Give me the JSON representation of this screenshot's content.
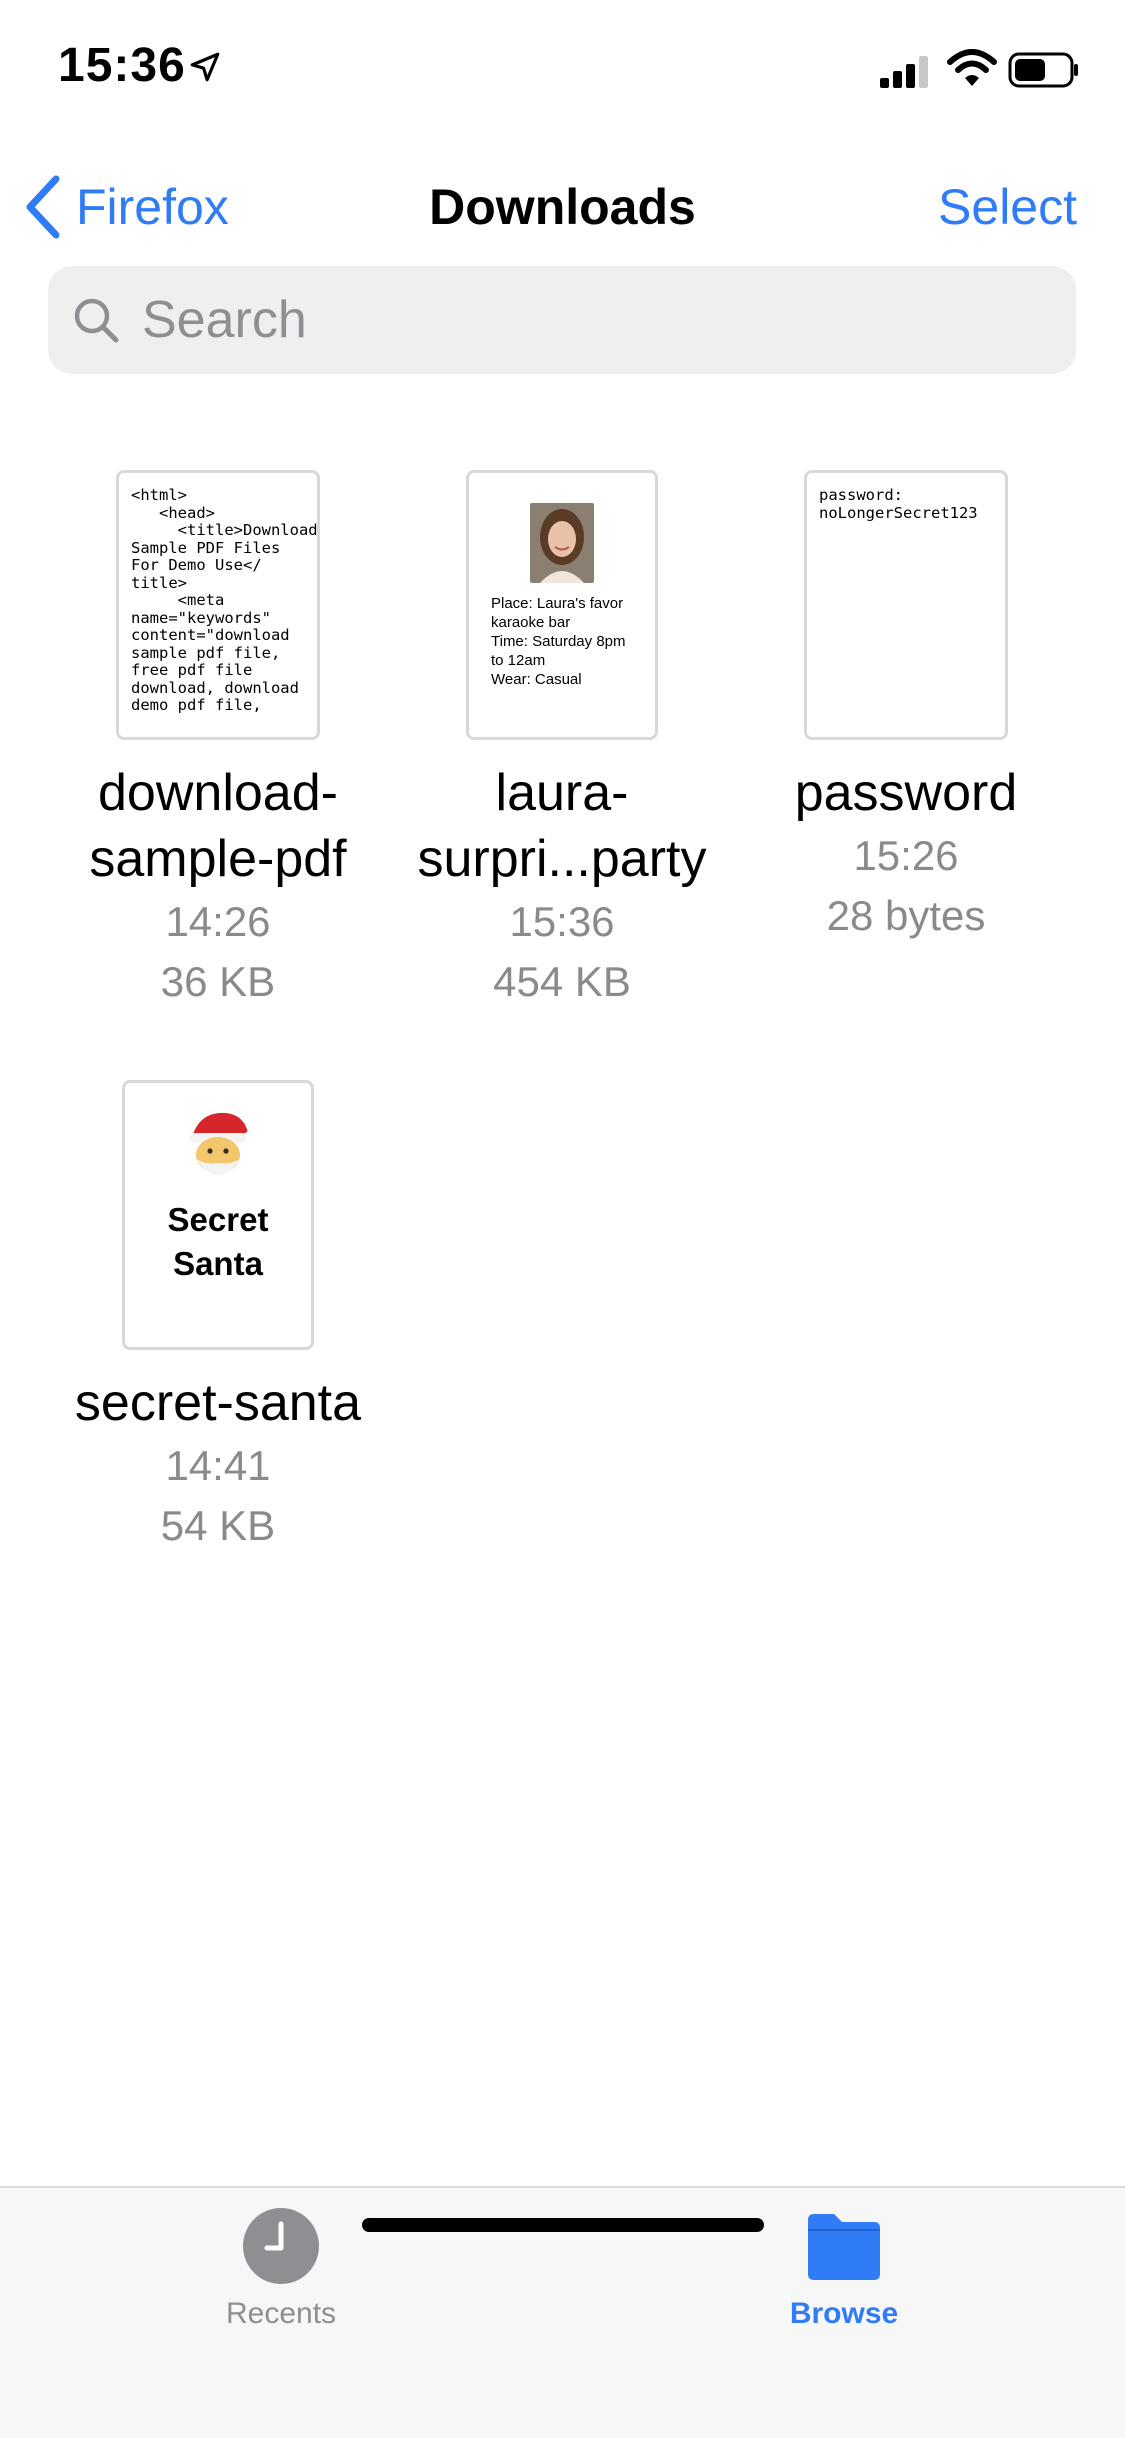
{
  "status_bar": {
    "time": "15:36"
  },
  "nav": {
    "back_label": "Firefox",
    "title": "Downloads",
    "select_label": "Select"
  },
  "search": {
    "placeholder": "Search",
    "value": ""
  },
  "files": [
    {
      "name_line1": "download-",
      "name_line2": "sample-pdf",
      "time": "14:26",
      "size": "36 KB",
      "preview": "<html>\n   <head>\n     <title>Download\nSample PDF Files\nFor Demo Use</\ntitle>\n     <meta\nname=\"keywords\"\ncontent=\"download\nsample pdf file,\nfree pdf file\ndownload, download\ndemo pdf file,"
    },
    {
      "name_line1": "laura-",
      "name_line2": "surpri...party",
      "time": "15:36",
      "size": "454 KB",
      "preview": "Place: Laura's favor\nkaraoke bar\nTime: Saturday 8pm\nto 12am\nWear: Casual"
    },
    {
      "name_line1": "password",
      "time": "15:26",
      "size": "28 bytes",
      "preview": "password:\nnoLongerSecret123"
    },
    {
      "name_line1": "secret-santa",
      "time": "14:41",
      "size": "54 KB",
      "preview": "Secret\nSanta"
    }
  ],
  "tab_bar": {
    "tabs": [
      {
        "label": "Recents",
        "icon": "clock-icon",
        "active": false
      },
      {
        "label": "Browse",
        "icon": "folder-icon",
        "active": true
      }
    ],
    "active_color": "#2f7cf6",
    "inactive_color": "#8e8e93"
  },
  "colors": {
    "accent": "#2f7cf6",
    "secondary_text": "#8a8a8e",
    "search_bg": "#efeff0"
  }
}
